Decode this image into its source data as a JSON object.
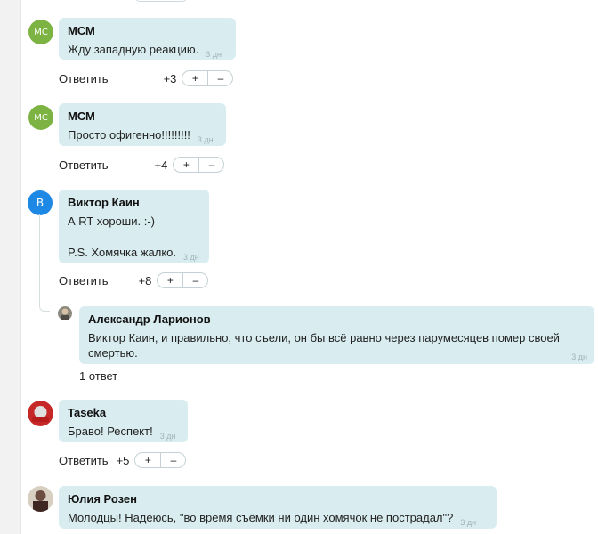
{
  "ui": {
    "reply_label": "Ответить",
    "plus": "+",
    "minus": "–"
  },
  "comments": [
    {
      "initials": "MC",
      "author": "МСМ",
      "text": "Жду западную реакцию.",
      "time": "3 дн",
      "score": "+3"
    },
    {
      "initials": "MC",
      "author": "МСМ",
      "text": "Просто офигенно!!!!!!!!!",
      "time": "3 дн",
      "score": "+4"
    },
    {
      "initials": "В",
      "author": "Виктор Каин",
      "text_line1": "А RT хороши. :-)",
      "text_line2": "P.S. Хомячка жалко.",
      "time": "3 дн",
      "score": "+8"
    },
    {
      "author": "Александр Ларионов",
      "mention": "Виктор Каин",
      "text_line1": ", и правильно, что съели, он бы всё равно через парумесяцев помер своей",
      "text_line2": "смертью.",
      "time": "3 дн",
      "replies": "1 ответ"
    },
    {
      "author": "Taseka",
      "text": "Браво! Респект!",
      "time": "3 дн",
      "score": "+5"
    },
    {
      "author": "Юлия Розен",
      "text": "Молодцы! Надеюсь, \"во время съёмки ни один хомячок не пострадал\"?",
      "time": "3 дн"
    }
  ]
}
